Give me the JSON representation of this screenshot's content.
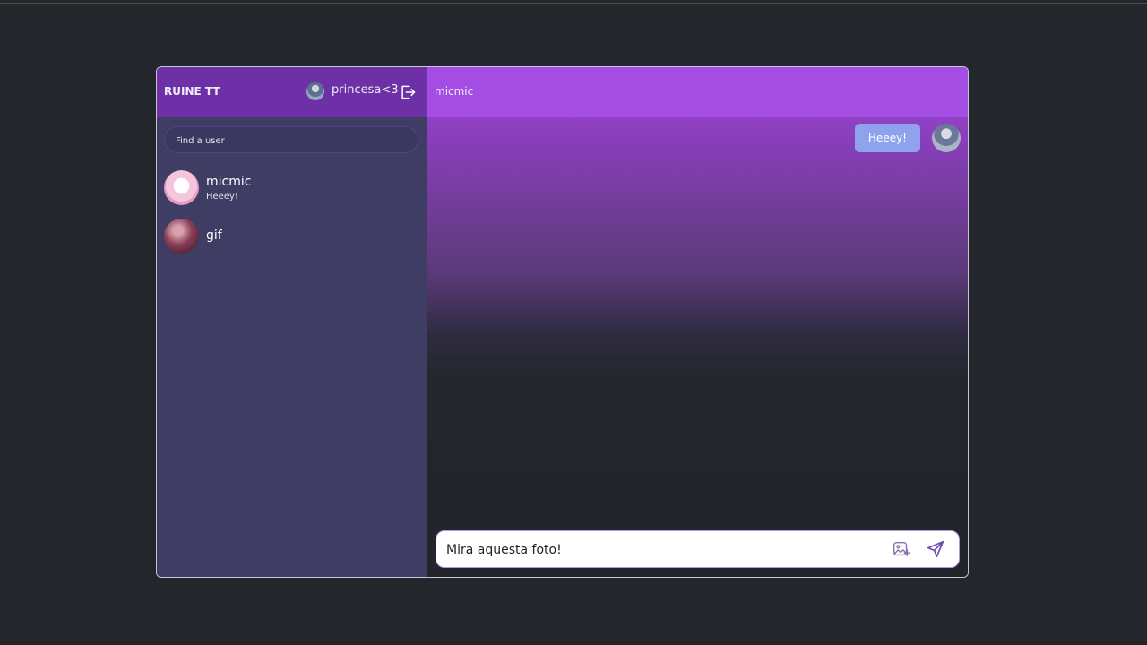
{
  "sidebar": {
    "brand": "RUINE TT",
    "current_user": "princesa<3",
    "logout_icon": "logout-icon",
    "search_placeholder": "Find a user",
    "contacts": [
      {
        "name": "micmic",
        "preview": "Heeey!"
      },
      {
        "name": "gif",
        "preview": ""
      }
    ]
  },
  "chat": {
    "title": "micmic",
    "messages": [
      {
        "text": "Heeey!"
      }
    ],
    "composer": {
      "value": "Mira aquesta foto!",
      "image_icon": "image-add-icon",
      "send_icon": "send-icon"
    }
  },
  "colors": {
    "sidebar_header": "#6d30a6",
    "sidebar_bg": "#3f3d63",
    "chat_header": "#a34de2",
    "bubble": "#8fa2ec"
  }
}
